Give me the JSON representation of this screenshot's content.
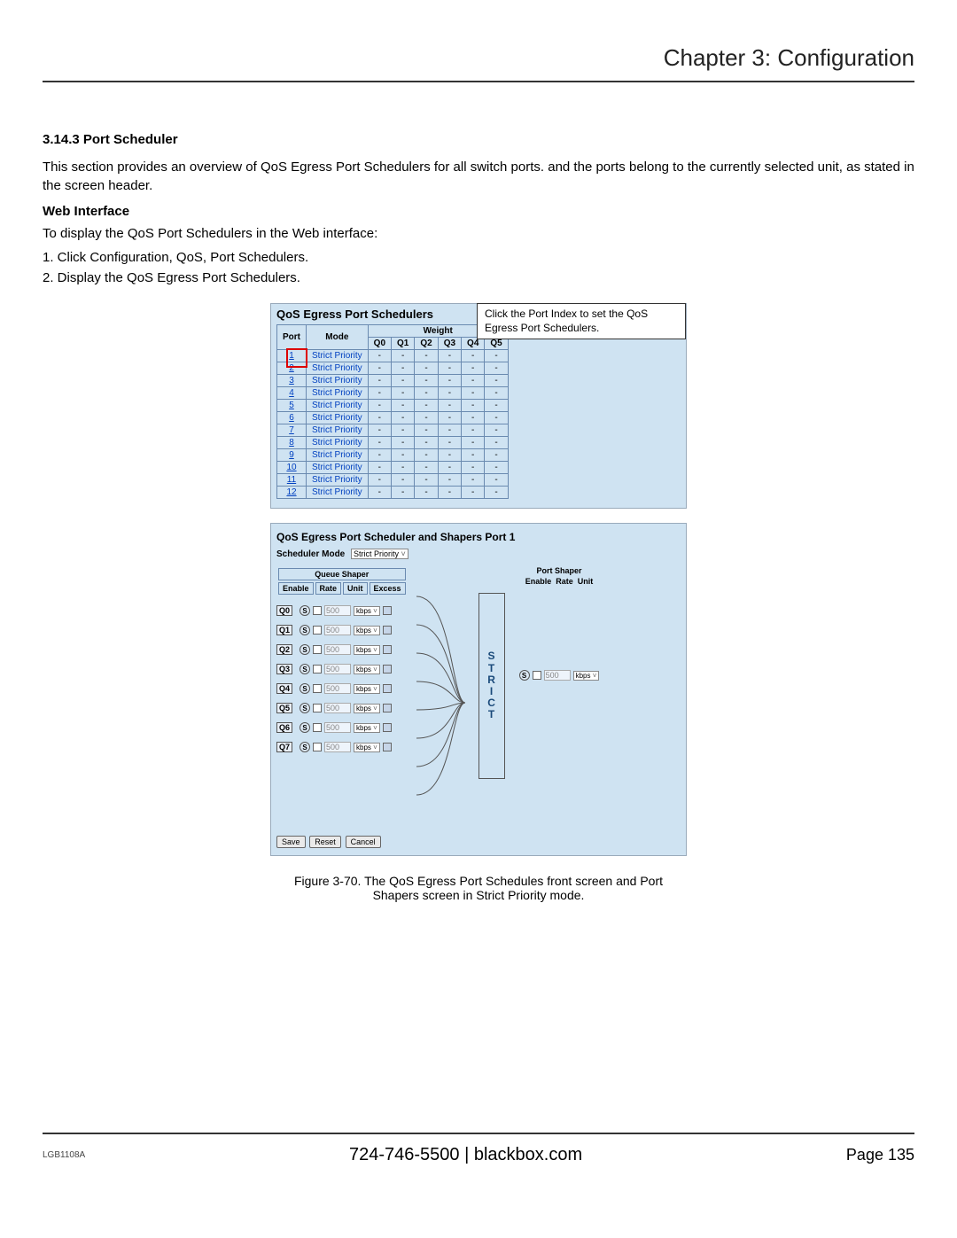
{
  "chapter_title": "Chapter 3: Configuration",
  "section_number": "3.14.3 Port Scheduler",
  "intro_para": "This section provides an overview of QoS Egress Port Schedulers for all switch ports. and the ports belong to the currently selected unit, as stated in the screen header.",
  "web_interface_head": "Web Interface",
  "web_interface_intro": "To display the QoS Port Schedulers in the Web interface:",
  "steps": [
    "1. Click Configuration, QoS, Port Schedulers.",
    "2. Display the QoS Egress Port Schedulers."
  ],
  "shot1": {
    "title": "QoS Egress Port Schedulers",
    "callout": "Click the Port Index to set the QoS Egress Port Schedulers.",
    "headers": {
      "port": "Port",
      "mode": "Mode",
      "weight": "Weight",
      "qcols": [
        "Q0",
        "Q1",
        "Q2",
        "Q3",
        "Q4",
        "Q5"
      ]
    },
    "rows": [
      {
        "port": "1",
        "mode": "Strict Priority"
      },
      {
        "port": "2",
        "mode": "Strict Priority"
      },
      {
        "port": "3",
        "mode": "Strict Priority"
      },
      {
        "port": "4",
        "mode": "Strict Priority"
      },
      {
        "port": "5",
        "mode": "Strict Priority"
      },
      {
        "port": "6",
        "mode": "Strict Priority"
      },
      {
        "port": "7",
        "mode": "Strict Priority"
      },
      {
        "port": "8",
        "mode": "Strict Priority"
      },
      {
        "port": "9",
        "mode": "Strict Priority"
      },
      {
        "port": "10",
        "mode": "Strict Priority"
      },
      {
        "port": "11",
        "mode": "Strict Priority"
      },
      {
        "port": "12",
        "mode": "Strict Priority"
      }
    ]
  },
  "shot2": {
    "title": "QoS Egress Port Scheduler and Shapers  Port 1",
    "sched_mode_label": "Scheduler Mode",
    "sched_mode_value": "Strict Priority",
    "queue_shaper_head": "Queue Shaper",
    "queue_cols": {
      "enable": "Enable",
      "rate": "Rate",
      "unit": "Unit",
      "excess": "Excess"
    },
    "queues": [
      {
        "name": "Q0",
        "rate": "500",
        "unit": "kbps"
      },
      {
        "name": "Q1",
        "rate": "500",
        "unit": "kbps"
      },
      {
        "name": "Q2",
        "rate": "500",
        "unit": "kbps"
      },
      {
        "name": "Q3",
        "rate": "500",
        "unit": "kbps"
      },
      {
        "name": "Q4",
        "rate": "500",
        "unit": "kbps"
      },
      {
        "name": "Q5",
        "rate": "500",
        "unit": "kbps"
      },
      {
        "name": "Q6",
        "rate": "500",
        "unit": "kbps"
      },
      {
        "name": "Q7",
        "rate": "500",
        "unit": "kbps"
      }
    ],
    "s_label": "S",
    "strict_block": "STRICT",
    "port_shaper_head": "Port Shaper",
    "port_shaper_cols": {
      "enable": "Enable",
      "rate": "Rate",
      "unit": "Unit"
    },
    "port_shaper": {
      "rate": "500",
      "unit": "kbps"
    },
    "buttons": {
      "save": "Save",
      "reset": "Reset",
      "cancel": "Cancel"
    }
  },
  "figure_caption": "Figure 3-70. The QoS Egress Port Schedules front screen and Port Shapers screen in Strict Priority mode.",
  "footer": {
    "model": "LGB1108A",
    "center": "724-746-5500   |   blackbox.com",
    "page": "Page 135"
  }
}
